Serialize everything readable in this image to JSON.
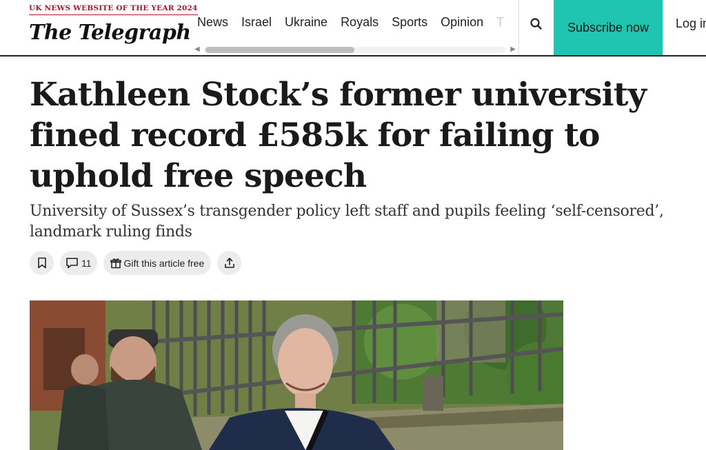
{
  "header": {
    "award": "UK NEWS WEBSITE OF THE YEAR 2024",
    "logo": "The Telegraph",
    "nav": [
      "News",
      "Israel",
      "Ukraine",
      "Royals",
      "Sports",
      "Opinion",
      "T"
    ],
    "subscribe": "Subscribe now",
    "login": "Log in",
    "accent_color": "#1fc5b0",
    "award_color": "#b0122b"
  },
  "article": {
    "headline": "Kathleen Stock’s former university fined record £585k for failing to uphold free speech",
    "standfirst": "University of Sussex’s transgender policy left staff and pupils feeling ‘self-censored’, landmark ruling finds",
    "comments_count": "11",
    "gift_label": "Gift this article free"
  },
  "icons": {
    "search": "search-icon",
    "bookmark": "bookmark-icon",
    "comment": "comment-icon",
    "gift": "gift-icon",
    "share": "share-icon"
  }
}
